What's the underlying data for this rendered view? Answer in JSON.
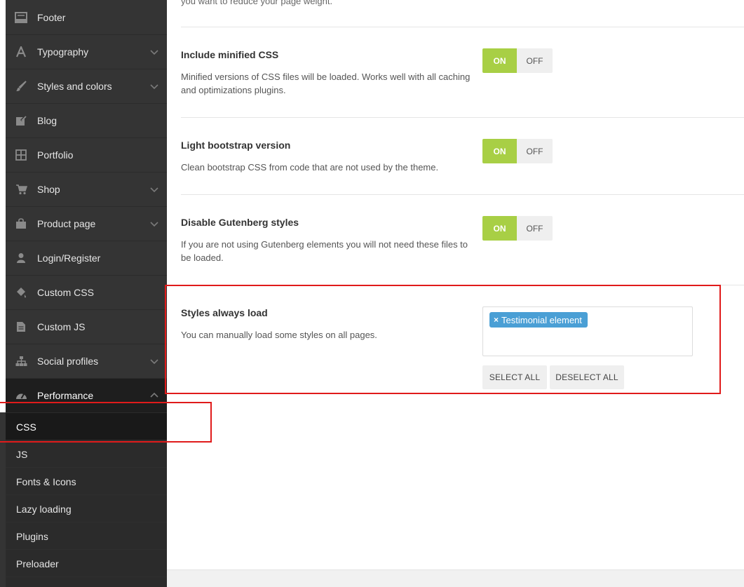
{
  "sidebar": {
    "items": [
      {
        "label": "Footer",
        "icon": "footer-icon",
        "has_chevron": false
      },
      {
        "label": "Typography",
        "icon": "typography-icon",
        "has_chevron": true
      },
      {
        "label": "Styles and colors",
        "icon": "brush-icon",
        "has_chevron": true
      },
      {
        "label": "Blog",
        "icon": "edit-icon",
        "has_chevron": false
      },
      {
        "label": "Portfolio",
        "icon": "grid-icon",
        "has_chevron": false
      },
      {
        "label": "Shop",
        "icon": "cart-icon",
        "has_chevron": true
      },
      {
        "label": "Product page",
        "icon": "bag-icon",
        "has_chevron": true
      },
      {
        "label": "Login/Register",
        "icon": "user-icon",
        "has_chevron": false
      },
      {
        "label": "Custom CSS",
        "icon": "paint-icon",
        "has_chevron": false
      },
      {
        "label": "Custom JS",
        "icon": "file-icon",
        "has_chevron": false
      },
      {
        "label": "Social profiles",
        "icon": "sitemap-icon",
        "has_chevron": true
      },
      {
        "label": "Performance",
        "icon": "dashboard-icon",
        "has_chevron": true,
        "expanded": true
      }
    ],
    "subitems": [
      {
        "label": "CSS",
        "current": true
      },
      {
        "label": "JS"
      },
      {
        "label": "Fonts & Icons"
      },
      {
        "label": "Lazy loading"
      },
      {
        "label": "Plugins"
      },
      {
        "label": "Preloader"
      }
    ]
  },
  "main": {
    "cut_text": "you want to reduce your page weight.",
    "options": [
      {
        "title": "Include minified CSS",
        "description": "Minified versions of CSS files will be loaded. Works well with all caching and optimizations plugins.",
        "on_label": "ON",
        "off_label": "OFF"
      },
      {
        "title": "Light bootstrap version",
        "description": "Clean bootstrap CSS from code that are not used by the theme.",
        "on_label": "ON",
        "off_label": "OFF"
      },
      {
        "title": "Disable Gutenberg styles",
        "description": "If you are not using Gutenberg elements you will not need these files to be loaded.",
        "on_label": "ON",
        "off_label": "OFF"
      },
      {
        "title": "Styles always load",
        "description": "You can manually load some styles on all pages.",
        "selected_chip": "Testimonial element",
        "chip_remove": "×",
        "select_all_label": "SELECT ALL",
        "deselect_all_label": "DESELECT ALL"
      }
    ]
  },
  "colors": {
    "sidebar_bg": "#343434",
    "toggle_on": "#a8cf45",
    "chip": "#4a9fd5",
    "annotation": "#e01b1b"
  }
}
